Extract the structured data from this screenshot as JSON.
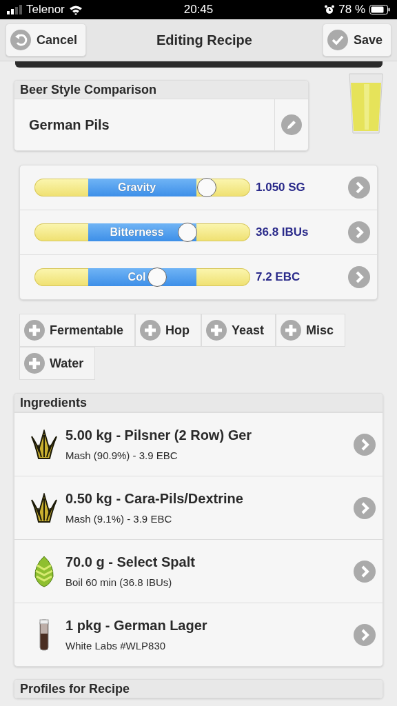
{
  "status_bar": {
    "carrier": "Telenor",
    "time": "20:45",
    "battery": "78 %"
  },
  "nav": {
    "cancel": "Cancel",
    "title": "Editing Recipe",
    "save": "Save"
  },
  "style_card": {
    "header": "Beer Style Comparison",
    "style": "German Pils"
  },
  "sliders": [
    {
      "label": "Gravity",
      "level": 0.8,
      "reading": "1.050 SG"
    },
    {
      "label": "Bitterness",
      "level": 0.71,
      "reading": "36.8 IBUs"
    },
    {
      "label": "Col",
      "level": 0.57,
      "reading": "7.2 EBC"
    }
  ],
  "add_buttons": [
    "Fermentable",
    "Hop",
    "Yeast",
    "Misc",
    "Water"
  ],
  "ingredients": {
    "header": "Ingredients",
    "items": [
      {
        "kind": "grain",
        "title": "5.00 kg - Pilsner (2 Row) Ger",
        "detail": "Mash (90.9%) - 3.9 EBC"
      },
      {
        "kind": "grain",
        "title": "0.50 kg - Cara-Pils/Dextrine",
        "detail": "Mash (9.1%) - 3.9 EBC"
      },
      {
        "kind": "hop",
        "title": "70.0 g - Select Spalt",
        "detail": "Boil 60 min (36.8 IBUs)"
      },
      {
        "kind": "yeast",
        "title": "1 pkg - German Lager",
        "detail": "White Labs #WLP830"
      }
    ]
  },
  "profiles": {
    "header": "Profiles for Recipe"
  }
}
